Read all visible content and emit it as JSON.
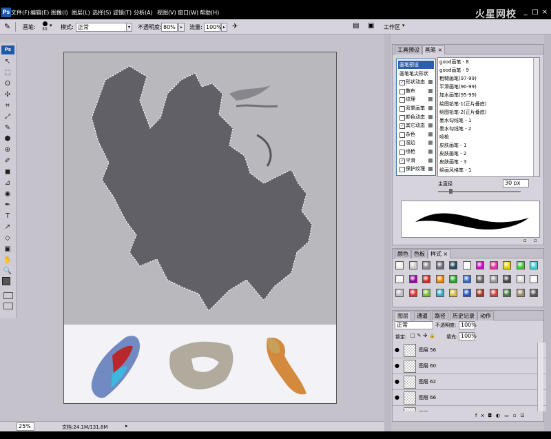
{
  "menubar": {
    "items": [
      "文件(F)",
      "编辑(E)",
      "图像(I)",
      "图层(L)",
      "选择(S)",
      "滤镜(T)",
      "分析(A)",
      "视图(V)",
      "窗口(W)",
      "帮助(H)"
    ],
    "watermark": "火星网校",
    "controls": [
      "_",
      "□",
      "×"
    ]
  },
  "options": {
    "brush_label": "画笔:",
    "brush_size": "30",
    "mode_label": "模式:",
    "mode_value": "正常",
    "opacity_label": "不透明度:",
    "opacity_value": "80%",
    "flow_label": "流量:",
    "flow_value": "100%",
    "workspace_label": "工作区"
  },
  "tools": [
    "↖",
    "⬚",
    "ʘ",
    "✣",
    "⌗",
    "⤢",
    "✎",
    "⬢",
    "⊕",
    "✐",
    "◼",
    "⊿",
    "◉",
    "✒",
    "T",
    "↗",
    "◇",
    "▣",
    "✋",
    "🔍"
  ],
  "status": {
    "zoom": "25%",
    "doc_info": "文档:24.1M/131.8M"
  },
  "brush_panel": {
    "tabs": [
      "工具预设",
      "画笔"
    ],
    "left_items": [
      {
        "label": "画笔预设",
        "selected": true,
        "check": false,
        "box": false
      },
      {
        "label": "画笔笔尖形状",
        "selected": false,
        "check": false,
        "box": false
      },
      {
        "label": "形状动态",
        "selected": false,
        "check": true,
        "box": true
      },
      {
        "label": "散布",
        "selected": false,
        "check": false,
        "box": true
      },
      {
        "label": "纹理",
        "selected": false,
        "check": false,
        "box": true
      },
      {
        "label": "双重画笔",
        "selected": false,
        "check": false,
        "box": true
      },
      {
        "label": "颜色动态",
        "selected": false,
        "check": false,
        "box": true
      },
      {
        "label": "其它动态",
        "selected": false,
        "check": true,
        "box": true
      },
      {
        "label": "杂色",
        "selected": false,
        "check": false,
        "box": true
      },
      {
        "label": "湿边",
        "selected": false,
        "check": false,
        "box": true
      },
      {
        "label": "喷枪",
        "selected": false,
        "check": false,
        "box": true
      },
      {
        "label": "平滑",
        "selected": false,
        "check": true,
        "box": true
      },
      {
        "label": "保护纹理",
        "selected": false,
        "check": false,
        "box": true
      }
    ],
    "brush_names": [
      "good画笔 - 8",
      "good画笔 - 9",
      "粗糙画笔(97-99)",
      "平滑画笔(90-99)",
      "加水画笔(95-99)",
      "绘图铅笔-1(正片叠底)",
      "绘图铅笔-2(正片叠底)",
      "墨水勾线笔 - 1",
      "墨水勾线笔 - 2",
      "喷枪",
      "皮肤画笔 - 1",
      "皮肤画笔 - 2",
      "皮肤画笔 - 3",
      "绘画风格笔 - 1"
    ],
    "diameter_label": "主直径",
    "diameter_value": "30 px"
  },
  "styles_panel": {
    "tabs": [
      "颜色",
      "色板",
      "样式"
    ],
    "swatch_colors": [
      [
        "#eeeeee",
        "#cccccc",
        "#8a8a8a",
        "#6a6a7a",
        "#1e4a5a",
        "#ffffff",
        "#cc00cc",
        "#e53399",
        "#e6d000",
        "#33cc33",
        "#44ccdd"
      ],
      [
        "#f3f3f3",
        "#9900aa",
        "#dd2222",
        "#ee8800",
        "#22aa22",
        "#3366cc",
        "#666666",
        "#999999",
        "#444444",
        "#dddddd",
        "#f5f5f5"
      ],
      [
        "#bbbbbb",
        "#dd3333",
        "#77bb33",
        "#33aacc",
        "#ddbb33",
        "#2255cc",
        "#aa3322",
        "#cc4444",
        "#447744",
        "#998866",
        "#555555"
      ]
    ]
  },
  "layers_panel": {
    "tabs": [
      "图层",
      "通道",
      "路径",
      "历史记录",
      "动作"
    ],
    "blend_mode": "正常",
    "opacity_label": "不透明度:",
    "opacity_value": "100%",
    "lock_label": "锁定:",
    "fill_label": "填充:",
    "fill_value": "100%",
    "layers": [
      {
        "name": "图层 56",
        "visible": true
      },
      {
        "name": "图层 60",
        "visible": true
      },
      {
        "name": "图层 62",
        "visible": true
      },
      {
        "name": "图层 66",
        "visible": true
      },
      {
        "name": "图层 63",
        "visible": true
      }
    ]
  }
}
